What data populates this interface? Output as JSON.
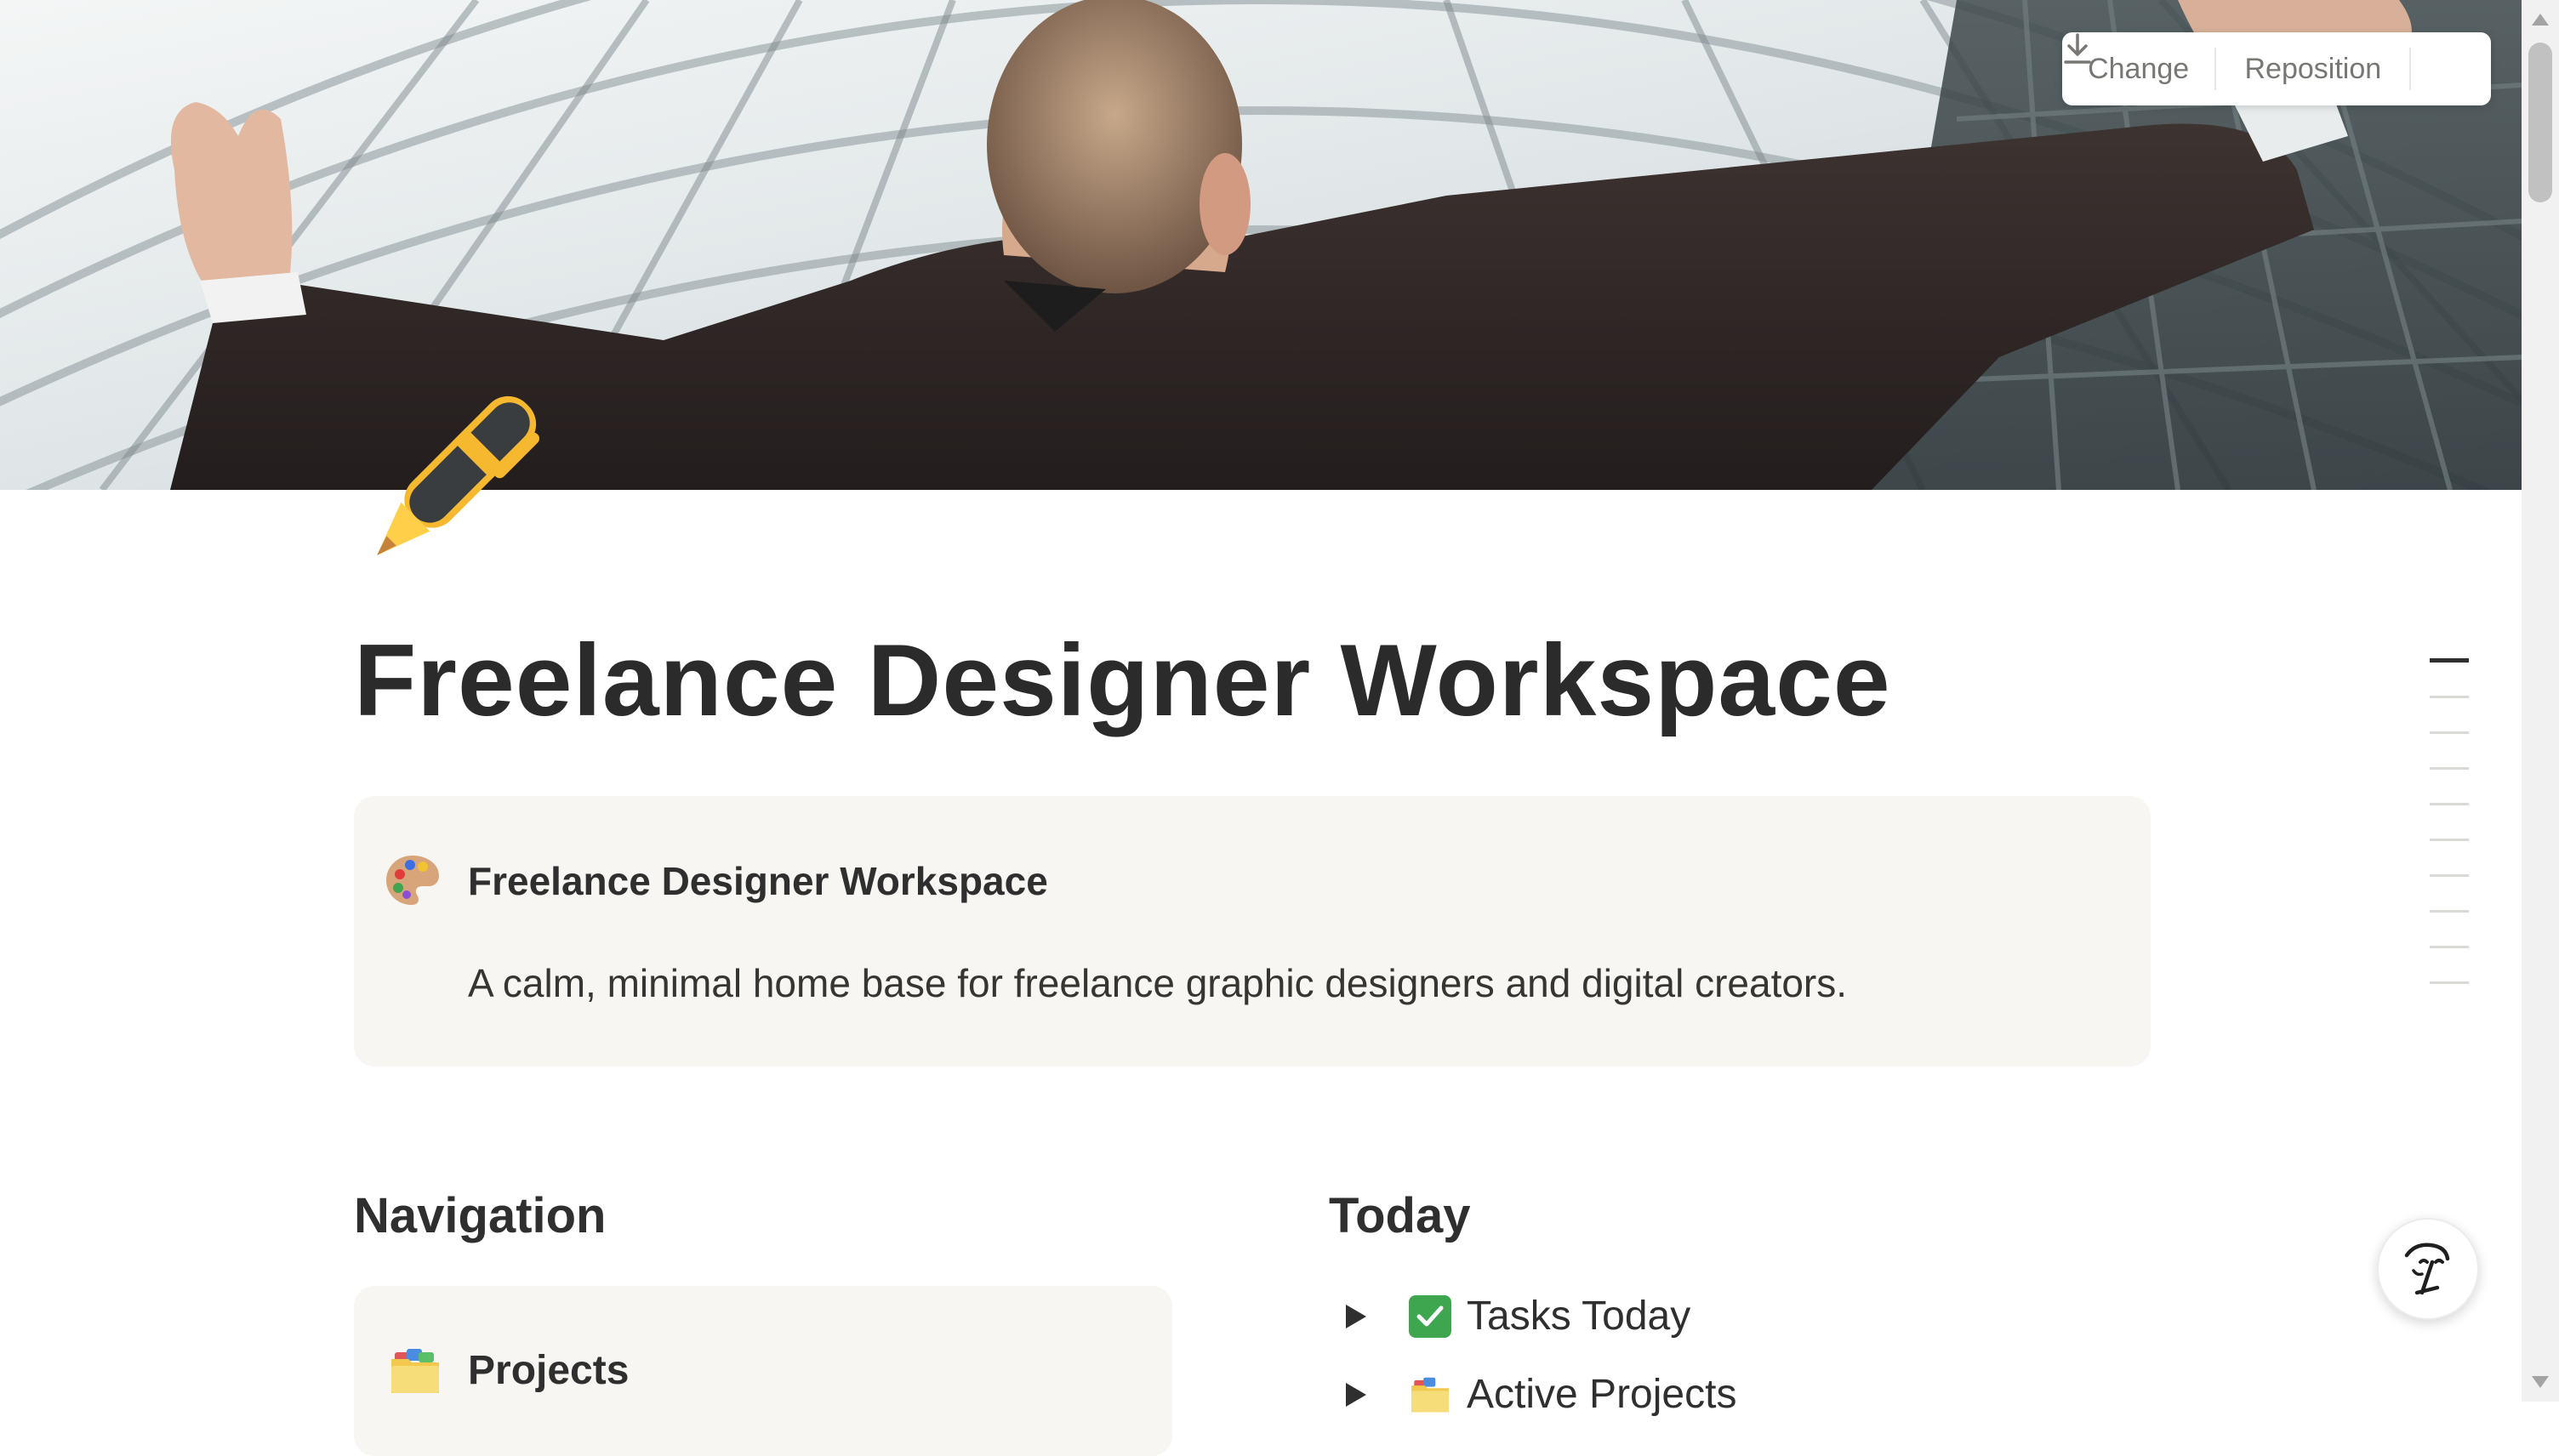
{
  "cover": {
    "description_icon": "cover-photo",
    "toolbar": {
      "change_label": "Change",
      "reposition_label": "Reposition",
      "download_icon": "download-icon"
    }
  },
  "page": {
    "icon": "pen-icon",
    "title": "Freelance Designer Workspace"
  },
  "callout": {
    "icon": "palette-icon",
    "title": "Freelance Designer Workspace",
    "description": "A calm, minimal home base for freelance graphic designers and digital creators."
  },
  "navigation": {
    "heading": "Navigation",
    "items": [
      {
        "icon": "folder-icon",
        "label": "Projects"
      }
    ]
  },
  "today": {
    "heading": "Today",
    "toggles": [
      {
        "icon": "check-mark-icon",
        "label": "Tasks Today"
      },
      {
        "icon": "folder-icon",
        "label": "Active Projects"
      }
    ]
  },
  "toc": {
    "dash_count": 10,
    "active_index": 0
  },
  "help_button": {
    "icon": "notion-ai-face-icon"
  },
  "colors": {
    "callout_bg": "#f7f6f3",
    "text": "#2f2f2f",
    "muted": "#787774",
    "check_green": "#3fa650"
  }
}
